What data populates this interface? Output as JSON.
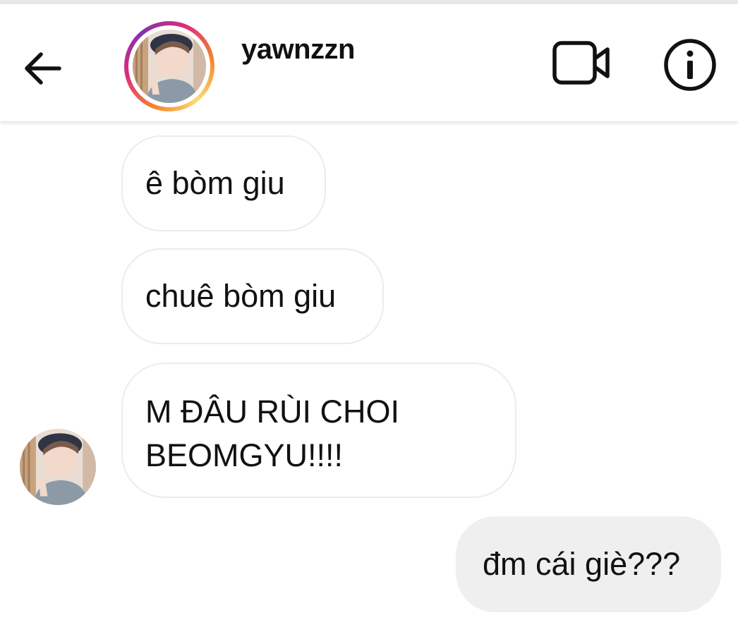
{
  "header": {
    "username": "yawnzzn",
    "back_icon": "arrow-left-icon",
    "video_icon": "video-camera-icon",
    "info_icon": "info-icon",
    "story_ring_colors": [
      "#f58529",
      "#dd2a7b",
      "#8134af",
      "#feda77"
    ]
  },
  "messages": [
    {
      "from": "them",
      "text": "ê bòm giu"
    },
    {
      "from": "them",
      "text": "chuê bòm giu"
    },
    {
      "from": "them",
      "text_lines": [
        "M ĐÂU RÙI CHOI",
        "BEOMGYU!!!!"
      ]
    },
    {
      "from": "me",
      "text": "đm cái giè???"
    }
  ],
  "colors": {
    "incoming_bubble_border": "#ececec",
    "outgoing_bubble_bg": "#efefef",
    "text": "#111111"
  }
}
